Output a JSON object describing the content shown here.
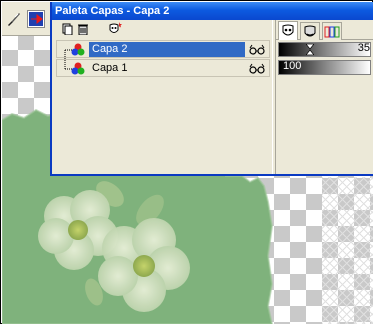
{
  "window": {
    "title": "Paleta Capas - Capa 2"
  },
  "layers": [
    {
      "name": "Capa 2",
      "selected": true,
      "visible": true,
      "icon": "raster-layer-icon"
    },
    {
      "name": "Capa 1",
      "selected": false,
      "visible": true,
      "icon": "raster-layer-icon"
    }
  ],
  "right_panel": {
    "tabs": [
      "mask-tab-icon",
      "blend-tab-icon",
      "rgb-channels-tab-icon"
    ],
    "blend_slider_value": "35",
    "opacity_value": "100"
  },
  "colors": {
    "titlebar": "#0a48cf",
    "selection": "#316ac5",
    "panel_bg": "#ece9d8",
    "canvas_green": "#7fb27c"
  }
}
